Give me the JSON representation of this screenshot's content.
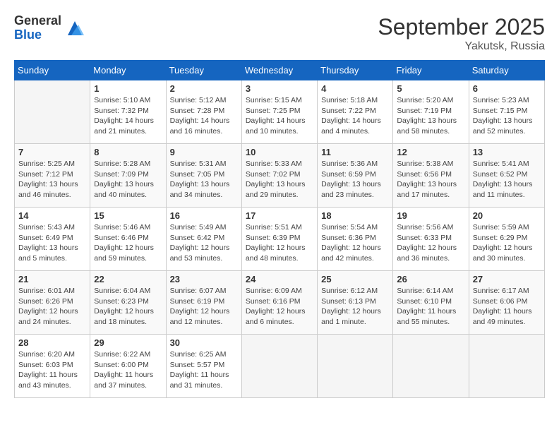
{
  "logo": {
    "general": "General",
    "blue": "Blue"
  },
  "title": {
    "month_year": "September 2025",
    "location": "Yakutsk, Russia"
  },
  "weekdays": [
    "Sunday",
    "Monday",
    "Tuesday",
    "Wednesday",
    "Thursday",
    "Friday",
    "Saturday"
  ],
  "weeks": [
    [
      {
        "day": "",
        "info": ""
      },
      {
        "day": "1",
        "info": "Sunrise: 5:10 AM\nSunset: 7:32 PM\nDaylight: 14 hours\nand 21 minutes."
      },
      {
        "day": "2",
        "info": "Sunrise: 5:12 AM\nSunset: 7:28 PM\nDaylight: 14 hours\nand 16 minutes."
      },
      {
        "day": "3",
        "info": "Sunrise: 5:15 AM\nSunset: 7:25 PM\nDaylight: 14 hours\nand 10 minutes."
      },
      {
        "day": "4",
        "info": "Sunrise: 5:18 AM\nSunset: 7:22 PM\nDaylight: 14 hours\nand 4 minutes."
      },
      {
        "day": "5",
        "info": "Sunrise: 5:20 AM\nSunset: 7:19 PM\nDaylight: 13 hours\nand 58 minutes."
      },
      {
        "day": "6",
        "info": "Sunrise: 5:23 AM\nSunset: 7:15 PM\nDaylight: 13 hours\nand 52 minutes."
      }
    ],
    [
      {
        "day": "7",
        "info": "Sunrise: 5:25 AM\nSunset: 7:12 PM\nDaylight: 13 hours\nand 46 minutes."
      },
      {
        "day": "8",
        "info": "Sunrise: 5:28 AM\nSunset: 7:09 PM\nDaylight: 13 hours\nand 40 minutes."
      },
      {
        "day": "9",
        "info": "Sunrise: 5:31 AM\nSunset: 7:05 PM\nDaylight: 13 hours\nand 34 minutes."
      },
      {
        "day": "10",
        "info": "Sunrise: 5:33 AM\nSunset: 7:02 PM\nDaylight: 13 hours\nand 29 minutes."
      },
      {
        "day": "11",
        "info": "Sunrise: 5:36 AM\nSunset: 6:59 PM\nDaylight: 13 hours\nand 23 minutes."
      },
      {
        "day": "12",
        "info": "Sunrise: 5:38 AM\nSunset: 6:56 PM\nDaylight: 13 hours\nand 17 minutes."
      },
      {
        "day": "13",
        "info": "Sunrise: 5:41 AM\nSunset: 6:52 PM\nDaylight: 13 hours\nand 11 minutes."
      }
    ],
    [
      {
        "day": "14",
        "info": "Sunrise: 5:43 AM\nSunset: 6:49 PM\nDaylight: 13 hours\nand 5 minutes."
      },
      {
        "day": "15",
        "info": "Sunrise: 5:46 AM\nSunset: 6:46 PM\nDaylight: 12 hours\nand 59 minutes."
      },
      {
        "day": "16",
        "info": "Sunrise: 5:49 AM\nSunset: 6:42 PM\nDaylight: 12 hours\nand 53 minutes."
      },
      {
        "day": "17",
        "info": "Sunrise: 5:51 AM\nSunset: 6:39 PM\nDaylight: 12 hours\nand 48 minutes."
      },
      {
        "day": "18",
        "info": "Sunrise: 5:54 AM\nSunset: 6:36 PM\nDaylight: 12 hours\nand 42 minutes."
      },
      {
        "day": "19",
        "info": "Sunrise: 5:56 AM\nSunset: 6:33 PM\nDaylight: 12 hours\nand 36 minutes."
      },
      {
        "day": "20",
        "info": "Sunrise: 5:59 AM\nSunset: 6:29 PM\nDaylight: 12 hours\nand 30 minutes."
      }
    ],
    [
      {
        "day": "21",
        "info": "Sunrise: 6:01 AM\nSunset: 6:26 PM\nDaylight: 12 hours\nand 24 minutes."
      },
      {
        "day": "22",
        "info": "Sunrise: 6:04 AM\nSunset: 6:23 PM\nDaylight: 12 hours\nand 18 minutes."
      },
      {
        "day": "23",
        "info": "Sunrise: 6:07 AM\nSunset: 6:19 PM\nDaylight: 12 hours\nand 12 minutes."
      },
      {
        "day": "24",
        "info": "Sunrise: 6:09 AM\nSunset: 6:16 PM\nDaylight: 12 hours\nand 6 minutes."
      },
      {
        "day": "25",
        "info": "Sunrise: 6:12 AM\nSunset: 6:13 PM\nDaylight: 12 hours\nand 1 minute."
      },
      {
        "day": "26",
        "info": "Sunrise: 6:14 AM\nSunset: 6:10 PM\nDaylight: 11 hours\nand 55 minutes."
      },
      {
        "day": "27",
        "info": "Sunrise: 6:17 AM\nSunset: 6:06 PM\nDaylight: 11 hours\nand 49 minutes."
      }
    ],
    [
      {
        "day": "28",
        "info": "Sunrise: 6:20 AM\nSunset: 6:03 PM\nDaylight: 11 hours\nand 43 minutes."
      },
      {
        "day": "29",
        "info": "Sunrise: 6:22 AM\nSunset: 6:00 PM\nDaylight: 11 hours\nand 37 minutes."
      },
      {
        "day": "30",
        "info": "Sunrise: 6:25 AM\nSunset: 5:57 PM\nDaylight: 11 hours\nand 31 minutes."
      },
      {
        "day": "",
        "info": ""
      },
      {
        "day": "",
        "info": ""
      },
      {
        "day": "",
        "info": ""
      },
      {
        "day": "",
        "info": ""
      }
    ]
  ]
}
